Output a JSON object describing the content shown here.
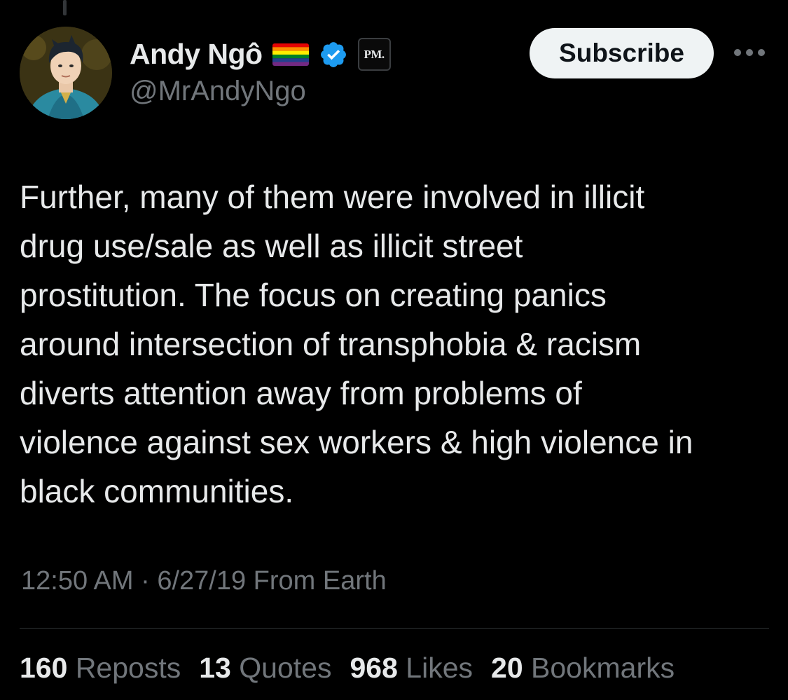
{
  "tweet": {
    "author": {
      "display_name": "Andy Ngô",
      "handle": "@MrAndyNgo",
      "badge_text": "PM.",
      "flag_icon": "rainbow-flag-icon",
      "verified_icon": "verified-badge-icon"
    },
    "subscribe_label": "Subscribe",
    "text": "Further, many of them were involved in illicit\ndrug use/sale as well as illicit street\nprostitution. The focus on creating panics\naround intersection of transphobia & racism\ndiverts attention away from problems of\nviolence against sex workers & high violence in\nblack communities.",
    "timestamp": "12:50 AM · 6/27/19 From Earth",
    "stats": [
      {
        "count": "160",
        "label": "Reposts"
      },
      {
        "count": "13",
        "label": "Quotes"
      },
      {
        "count": "968",
        "label": "Likes"
      },
      {
        "count": "20",
        "label": "Bookmarks"
      }
    ]
  },
  "colors": {
    "background": "#000000",
    "text_primary": "#e7e9ea",
    "text_secondary": "#71767b",
    "verified_blue": "#1d9bf0",
    "button_bg": "#eff3f4"
  }
}
